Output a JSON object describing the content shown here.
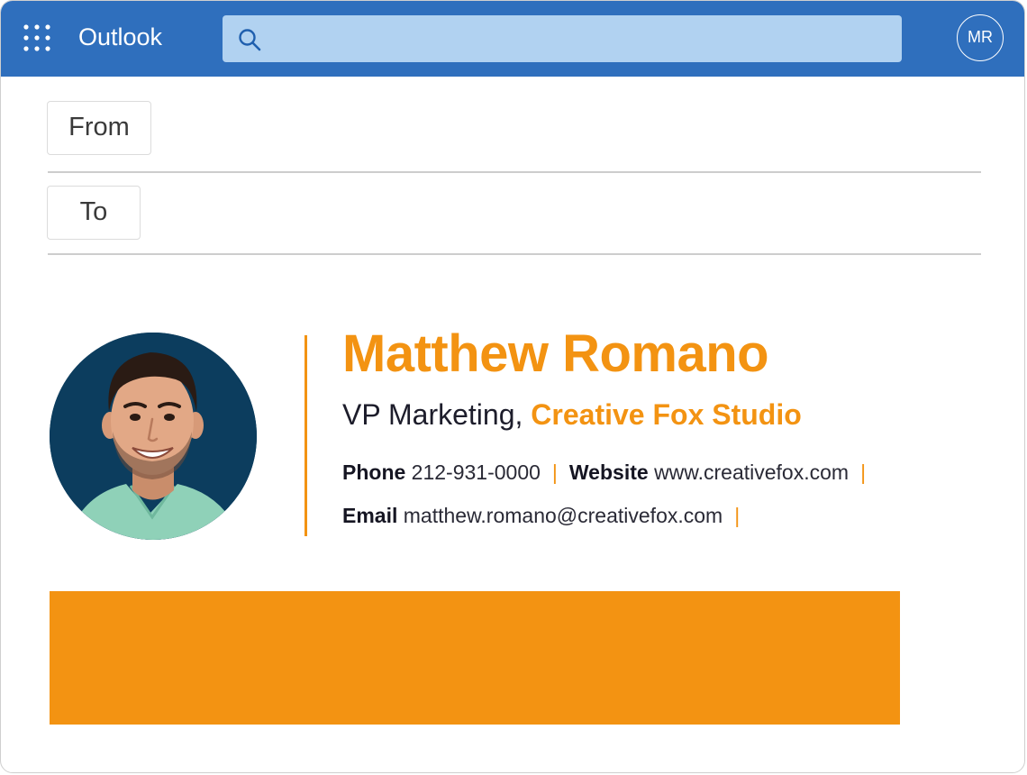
{
  "topbar": {
    "app_name": "Outlook",
    "apps_icon": "app-launcher-grid-icon",
    "search": {
      "icon": "search-icon",
      "placeholder": "",
      "value": ""
    },
    "account_initials": "MR",
    "color": "#2f6fbd",
    "search_color": "#b1d2f1"
  },
  "compose": {
    "from_label": "From",
    "to_label": "To"
  },
  "signature": {
    "name": "Matthew Romano",
    "job_title": "VP Marketing,",
    "company": "Creative Fox Studio",
    "phone_label": "Phone",
    "phone": "212-931-0000",
    "website_label": "Website",
    "website": "www.creativefox.com",
    "email_label": "Email",
    "email": "matthew.romano@creativefox.com",
    "separator": "|",
    "accent_color": "#f39312",
    "photo_icon": "profile-photo"
  }
}
